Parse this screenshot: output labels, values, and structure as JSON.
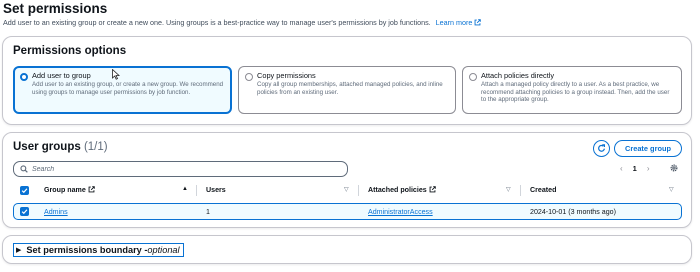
{
  "header": {
    "title": "Set permissions",
    "description": "Add user to an existing group or create a new one. Using groups is a best-practice way to manage user's permissions by job functions.",
    "learn_more": "Learn more"
  },
  "permissions_options": {
    "title": "Permissions options",
    "options": [
      {
        "label": "Add user to group",
        "description": "Add user to an existing group, or create a new group. We recommend using groups to manage user permissions by job function.",
        "selected": true
      },
      {
        "label": "Copy permissions",
        "description": "Copy all group memberships, attached managed policies, and inline policies from an existing user.",
        "selected": false
      },
      {
        "label": "Attach policies directly",
        "description": "Attach a managed policy directly to a user. As a best practice, we recommend attaching policies to a group instead. Then, add the user to the appropriate group.",
        "selected": false
      }
    ]
  },
  "user_groups": {
    "title": "User groups",
    "count": "(1/1)",
    "create_button": "Create group",
    "search_placeholder": "Search",
    "pagination": {
      "page": "1",
      "prev": "‹",
      "next": "›"
    },
    "columns": [
      "Group name",
      "Users",
      "Attached policies",
      "Created"
    ],
    "rows": [
      {
        "group_name": "Admins",
        "users": "1",
        "attached_policies": "AdministratorAccess",
        "created": "2024-10-01 (3 months ago)",
        "selected": true
      }
    ]
  },
  "boundary": {
    "label": "Set permissions boundary - ",
    "optional": "optional"
  },
  "colors": {
    "accent": "#0972d3",
    "selected_bg": "#f0fbff",
    "border": "#c6c6cd",
    "text": "#0f141a",
    "muted": "#5f6b7a"
  },
  "icons": [
    "external-link-icon",
    "refresh-icon",
    "search-icon",
    "chevron-left-icon",
    "chevron-right-icon",
    "settings-gear-icon",
    "sort-icon",
    "checkbox-checked-icon",
    "caret-right-icon",
    "mouse-cursor-icon"
  ]
}
